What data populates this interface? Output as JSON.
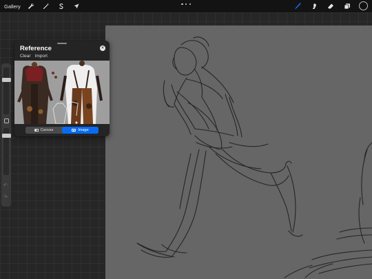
{
  "toolbar": {
    "gallery_label": "Gallery",
    "left_tools": [
      {
        "name": "adjustments",
        "icon": "wrench-icon"
      },
      {
        "name": "adjust-effects",
        "icon": "magic-wand-icon"
      },
      {
        "name": "selection",
        "icon": "selection-s-icon"
      },
      {
        "name": "transform",
        "icon": "arrow-cursor-icon"
      }
    ],
    "more_icon": "ellipsis-icon",
    "right_tools": [
      {
        "name": "brush",
        "icon": "brush-icon",
        "active": true
      },
      {
        "name": "smudge",
        "icon": "smudge-icon",
        "active": false
      },
      {
        "name": "eraser",
        "icon": "eraser-icon",
        "active": false
      },
      {
        "name": "layers",
        "icon": "layers-icon",
        "active": false
      }
    ],
    "current_color": "#111111",
    "accent_color": "#1a73ff"
  },
  "reference": {
    "title": "Reference",
    "clear_label": "Clear",
    "import_label": "Import",
    "close_icon": "close-icon",
    "segments": [
      {
        "label": "Canvas",
        "active": false,
        "icon": "canvas-icon"
      },
      {
        "label": "Image",
        "active": true,
        "icon": "image-icon"
      }
    ]
  },
  "sidebar": {
    "brush_size_icon": "size-slider",
    "opacity_icon": "opacity-slider",
    "modify_icon": "square-modify-icon",
    "undo_icon": "undo-icon",
    "redo_icon": "redo-icon"
  },
  "colors": {
    "canvas_bg": "#666666",
    "panel_bg": "#242424",
    "segment_active": "#0a6bf2"
  }
}
